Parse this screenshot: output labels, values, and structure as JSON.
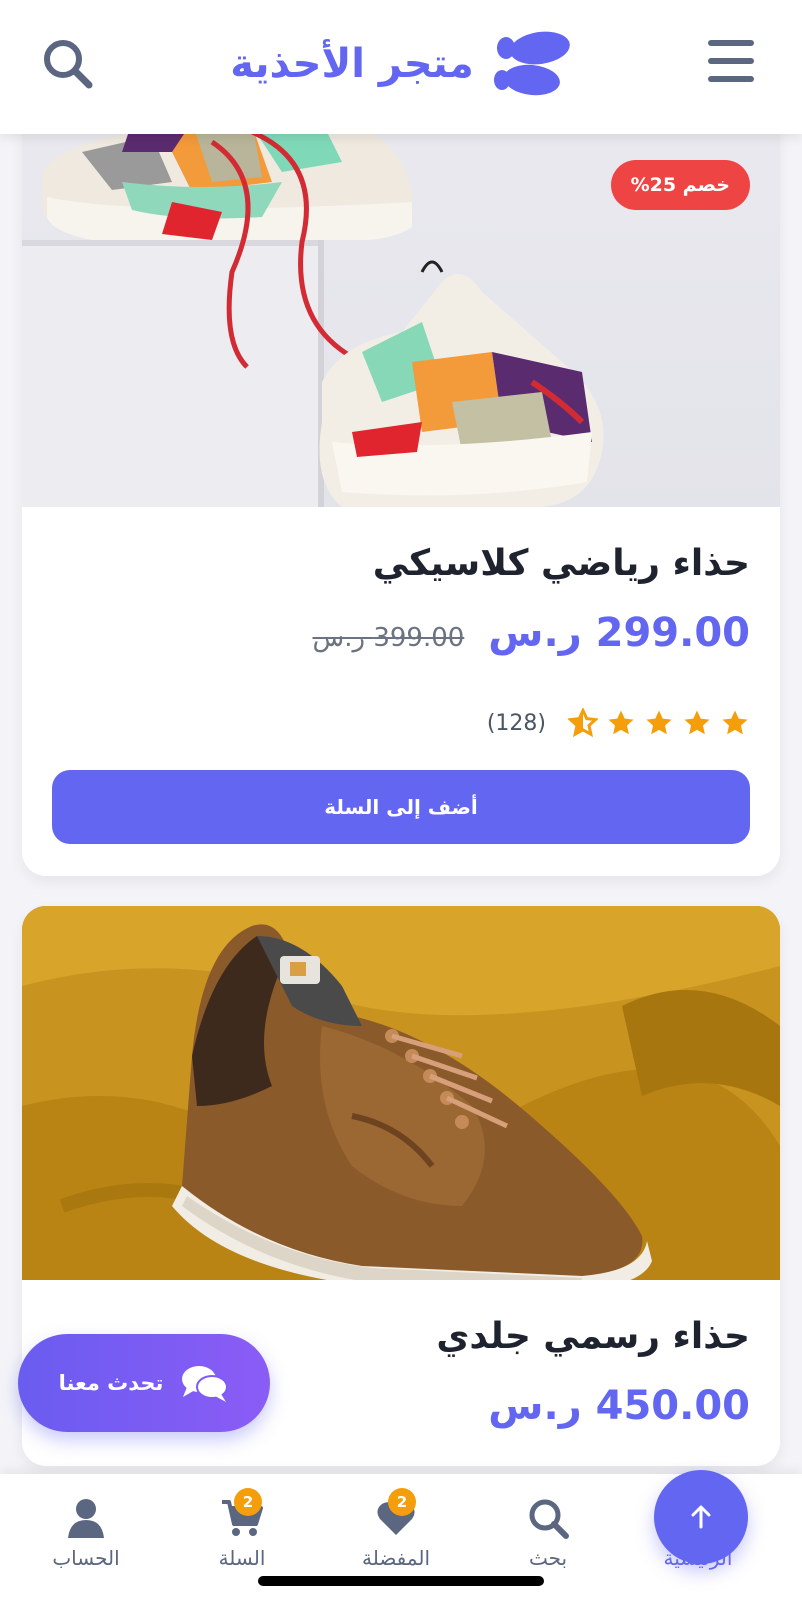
{
  "header": {
    "title": "متجر الأحذية"
  },
  "products": [
    {
      "badge": "خصم 25%",
      "title": "حذاء رياضي كلاسيكي",
      "price": "299.00 ر.س",
      "old_price": "399.00 ر.س",
      "rating": 4.5,
      "reviews": "(128)",
      "add_label": "أضف إلى السلة"
    },
    {
      "title": "حذاء رسمي جلدي",
      "price": "450.00 ر.س"
    }
  ],
  "chat": {
    "label": "تحدث معنا"
  },
  "bottom_nav": {
    "items": [
      {
        "label": "الرئيسية",
        "icon": "home-icon"
      },
      {
        "label": "بحث",
        "icon": "search-icon"
      },
      {
        "label": "المفضلة",
        "icon": "heart-icon",
        "count": "2"
      },
      {
        "label": "السلة",
        "icon": "cart-icon",
        "count": "2"
      },
      {
        "label": "الحساب",
        "icon": "user-icon"
      }
    ]
  },
  "colors": {
    "accent": "#6366f1",
    "badge": "#ef4444",
    "star": "#f59e0b",
    "count_badge": "#f59e0b"
  }
}
